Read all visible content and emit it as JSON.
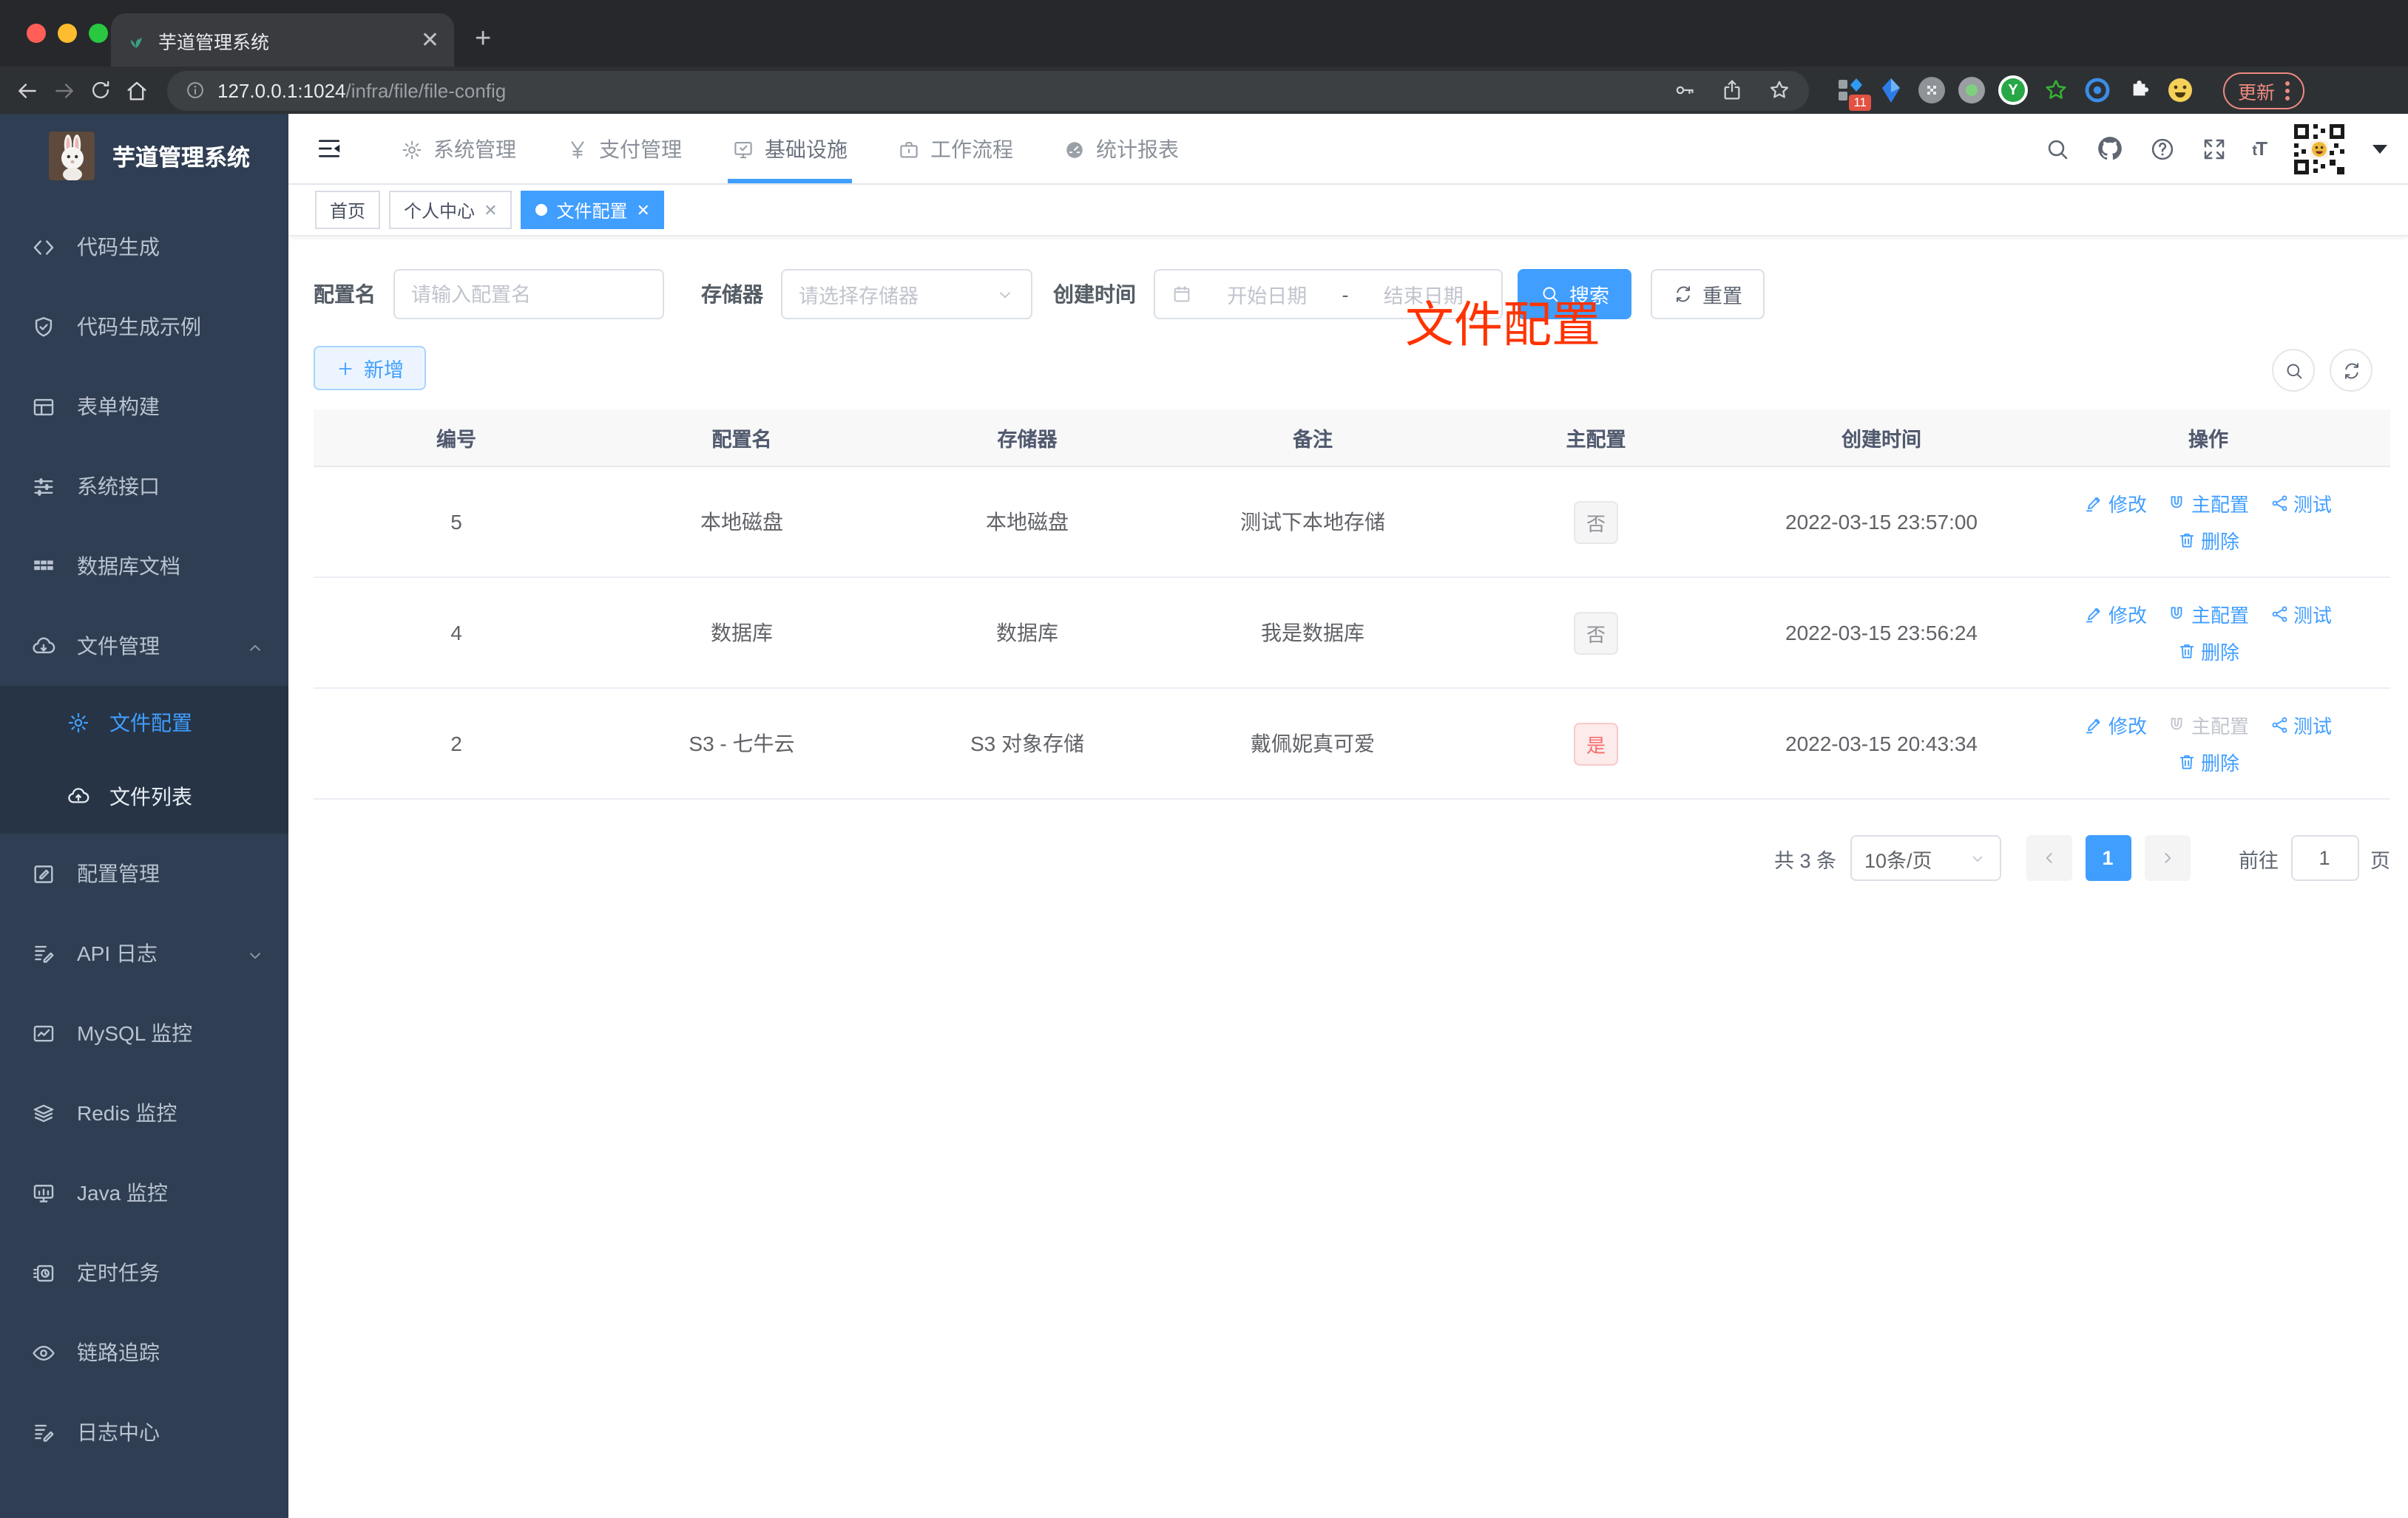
{
  "browser": {
    "tab_title": "芋道管理系统",
    "url_host": "127.0.0.1:1024",
    "url_path": "/infra/file/file-config",
    "ext_badge": "11",
    "update_label": "更新"
  },
  "colors": {
    "primary": "#409eff",
    "danger": "#f56c6c",
    "annotation_red": "#ff3300",
    "sidebar_bg": "#2f3e52"
  },
  "sidebar": {
    "title": "芋道管理系统",
    "items": [
      {
        "label": "代码生成"
      },
      {
        "label": "代码生成示例"
      },
      {
        "label": "表单构建"
      },
      {
        "label": "系统接口"
      },
      {
        "label": "数据库文档"
      },
      {
        "label": "文件管理"
      },
      {
        "label": "文件配置"
      },
      {
        "label": "文件列表"
      },
      {
        "label": "配置管理"
      },
      {
        "label": "API 日志"
      },
      {
        "label": "MySQL 监控"
      },
      {
        "label": "Redis 监控"
      },
      {
        "label": "Java 监控"
      },
      {
        "label": "定时任务"
      },
      {
        "label": "链路追踪"
      },
      {
        "label": "日志中心"
      }
    ]
  },
  "topnav": {
    "items": [
      {
        "label": "系统管理"
      },
      {
        "label": "支付管理"
      },
      {
        "label": "基础设施"
      },
      {
        "label": "工作流程"
      },
      {
        "label": "统计报表"
      }
    ],
    "font_size_icon": "tT"
  },
  "tags": {
    "items": [
      {
        "label": "首页"
      },
      {
        "label": "个人中心"
      },
      {
        "label": "文件配置"
      }
    ]
  },
  "annotation": {
    "title": "文件配置"
  },
  "filters": {
    "name_label": "配置名",
    "name_placeholder": "请输入配置名",
    "storage_label": "存储器",
    "storage_placeholder": "请选择存储器",
    "time_label": "创建时间",
    "start_placeholder": "开始日期",
    "range_separator": "-",
    "end_placeholder": "结束日期",
    "search_label": "搜索",
    "reset_label": "重置"
  },
  "toolbar": {
    "add_label": "新增"
  },
  "table": {
    "columns": [
      "编号",
      "配置名",
      "存储器",
      "备注",
      "主配置",
      "创建时间",
      "操作"
    ],
    "actions": {
      "edit": "修改",
      "master": "主配置",
      "test": "测试",
      "del": "删除"
    },
    "rows": [
      {
        "id": "5",
        "name": "本地磁盘",
        "storage": "本地磁盘",
        "remark": "测试下本地存储",
        "primary": "否",
        "created": "2022-03-15 23:57:00"
      },
      {
        "id": "4",
        "name": "数据库",
        "storage": "数据库",
        "remark": "我是数据库",
        "primary": "否",
        "created": "2022-03-15 23:56:24"
      },
      {
        "id": "2",
        "name": "S3 - 七牛云",
        "storage": "S3 对象存储",
        "remark": "戴佩妮真可爱",
        "primary": "是",
        "created": "2022-03-15 20:43:34"
      }
    ]
  },
  "pagination": {
    "total": "共 3 条",
    "page_size": "10条/页",
    "current": "1",
    "goto_label": "前往",
    "goto_value": "1",
    "page_label": "页"
  }
}
